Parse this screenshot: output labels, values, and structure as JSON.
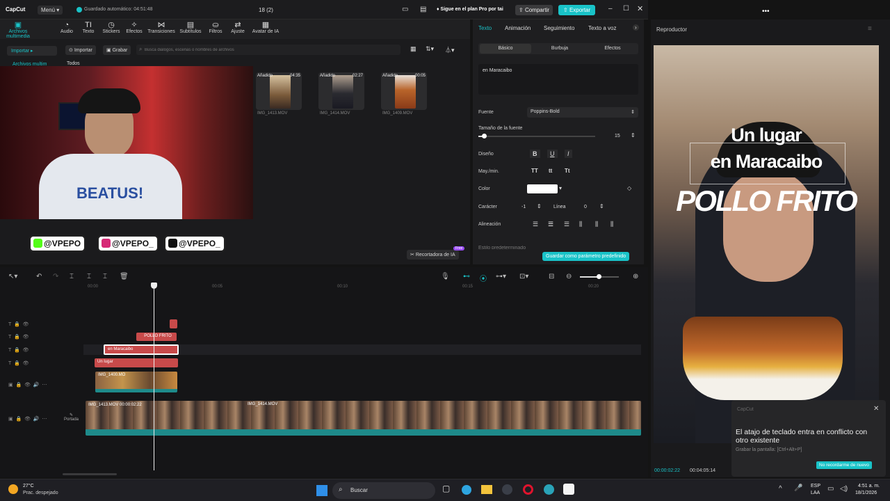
{
  "app": {
    "name": "CapCut",
    "menu": "Menú",
    "autosave": "Guardado automático: 04:51:48",
    "project": "18 (2)",
    "pro": "Sigue en el plan Pro por tai",
    "share": "Compartir",
    "export": "Exportar"
  },
  "toolbar": {
    "items": [
      "Archivos multimedia",
      "Audio",
      "Texto",
      "Stickers",
      "Efectos",
      "Transiciones",
      "Subtítulos",
      "Filtros",
      "Ajuste",
      "Avatar de IA"
    ]
  },
  "library": {
    "import_btn": "Importar",
    "import_tab": "Importar",
    "record_tab": "Grabar",
    "search_placeholder": "Busca diálogos, escenas o nombres de archivos",
    "side_label": "Archivos multim",
    "filter_all": "Todos",
    "recorder": "Recortadora de IA",
    "recorder_badge": "Free",
    "items": [
      {
        "tag": "Añadido",
        "dur": "04:35",
        "name": "IMG_1413.MOV"
      },
      {
        "tag": "Añadido",
        "dur": "02:27",
        "name": "IMG_1414.MOV"
      },
      {
        "tag": "Añadido",
        "dur": "00:05",
        "name": "IMG_1409.MOV"
      }
    ]
  },
  "overlay": {
    "socials": [
      "@VPEPO",
      "@VPEPO_",
      "@VPEPO_"
    ]
  },
  "props": {
    "tabs": [
      "Texto",
      "Animación",
      "Seguimiento",
      "Texto a voz"
    ],
    "subtabs": [
      "Básico",
      "Burbuja",
      "Efectos"
    ],
    "text_value": "en Maracaibo",
    "font_label": "Fuente",
    "font_value": "Poppins-Bold",
    "size_label": "Tamaño de la fuente",
    "size_value": "15",
    "size_fraction": 0.05,
    "design_label": "Diseño",
    "case_label": "May./min.",
    "color_label": "Color",
    "color_value": "#ffffff",
    "char_label": "Carácter",
    "char_value": "-1",
    "line_label": "Línea",
    "line_value": "0",
    "align_label": "Alineación",
    "cut_label": "Estilo predeterminado",
    "save_default": "Guardar como parámetro predefinido"
  },
  "player": {
    "title": "Reproductor",
    "caption_line1": "Un lugar",
    "caption_line2": "en Maracaibo",
    "caption_main": "POLLO FRITO",
    "time_current": "00:00:02:22",
    "time_total": "00:04:05:14"
  },
  "timeline": {
    "ticks": [
      "00:00",
      "00:05",
      "00:10",
      "00:15",
      "00:20"
    ],
    "clips": {
      "pollo": "POLLO FRITO",
      "maracaibo": "en Maracaibo",
      "lugar": "Un lugar",
      "img_small": "IMG_1400.MO",
      "main_a": "IMG_1413.MOV 00:00:02:22",
      "main_b": "IMG_1414.MOV"
    },
    "cover": "Portada"
  },
  "notification": {
    "app": "CapCut",
    "title": "El atajo de teclado entra en conflicto con otro existente",
    "body": "Grabar la pantalla: [Ctrl+Alt+P]",
    "button": "No recordarme de nuevo"
  },
  "taskbar": {
    "temp": "27°C",
    "weather": "Prac. despejado",
    "search": "Buscar",
    "lang1": "ESP",
    "lang2": "LAA",
    "time": "4:51 a. m.",
    "date": "18/1/2026"
  }
}
